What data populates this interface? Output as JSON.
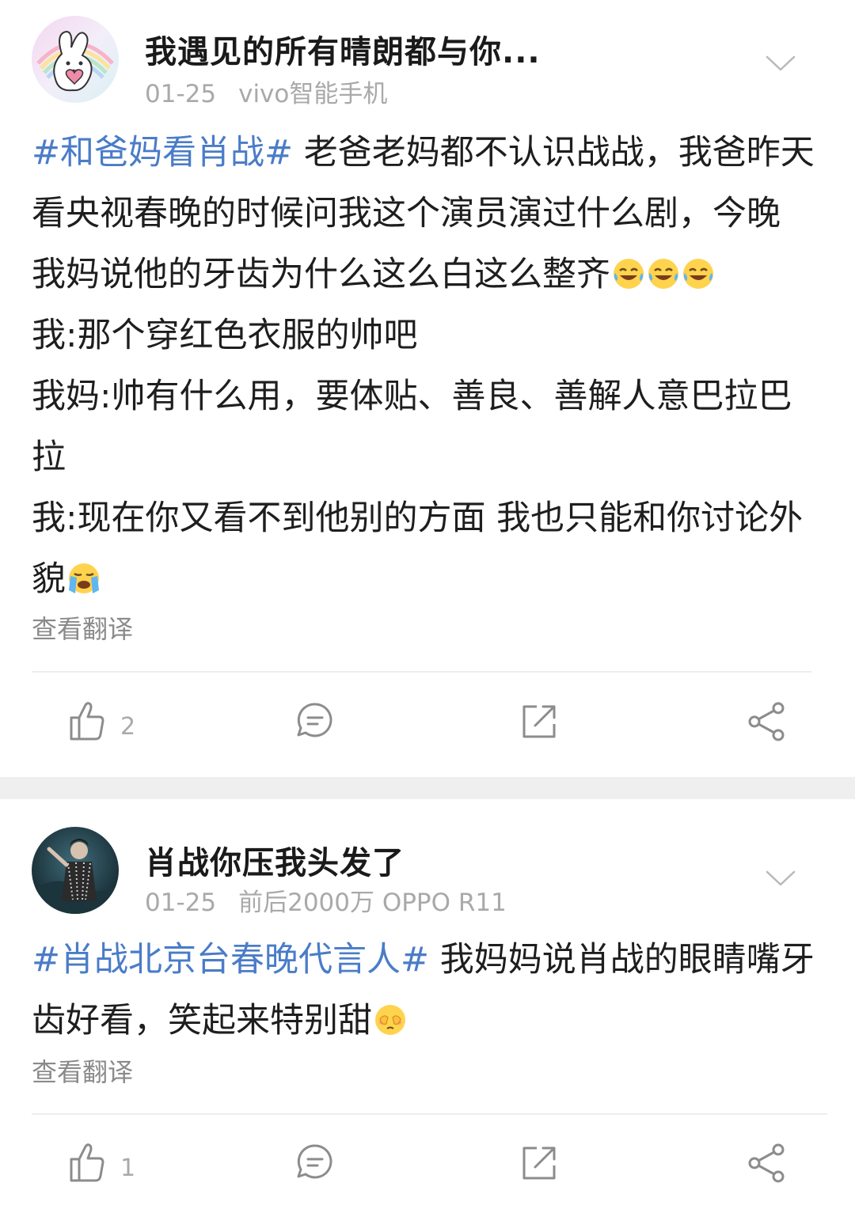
{
  "posts": [
    {
      "username": "我遇见的所有晴朗都与你...",
      "date": "01-25",
      "device": "vivo智能手机",
      "content_lines": [
        {
          "tag": "#和爸妈看肖战#",
          "text": " 老爸老妈都不认识战战，我爸昨天"
        },
        {
          "text": "看央视春晚的时候问我这个演员演过什么剧，今晚"
        },
        {
          "text": "我妈说他的牙齿为什么这么白这么整齐"
        },
        {
          "text": "我:那个穿红色衣服的帅吧"
        },
        {
          "text": "我妈:帅有什么用，要体贴、善良、善解人意巴拉巴"
        },
        {
          "text": "拉"
        },
        {
          "text": "我:现在你又看不到他别的方面 我也只能和你讨论外"
        },
        {
          "text": "貌"
        }
      ],
      "translate_label": "查看翻译",
      "like_count": "2",
      "emojis": [
        "laugh-cry-emoji",
        "laugh-cry-emoji",
        "laugh-cry-emoji",
        "sob-emoji"
      ]
    },
    {
      "username": "肖战你压我头发了",
      "date": "01-25",
      "device": "前后2000万 OPPO R11",
      "content_lines": [
        {
          "tag": "#肖战北京台春晚代言人#",
          "text": " 我妈妈说肖战的眼睛嘴牙"
        },
        {
          "text": "齿好看，笑起来特别甜"
        }
      ],
      "translate_label": "查看翻译",
      "like_count": "1",
      "emojis": [
        "shy-emoji"
      ]
    }
  ],
  "colors": {
    "hashtag": "#4a7cc8",
    "meta_gray": "#a9a9a9",
    "icon_gray": "#8c8c8c",
    "separator": "#efefef"
  }
}
